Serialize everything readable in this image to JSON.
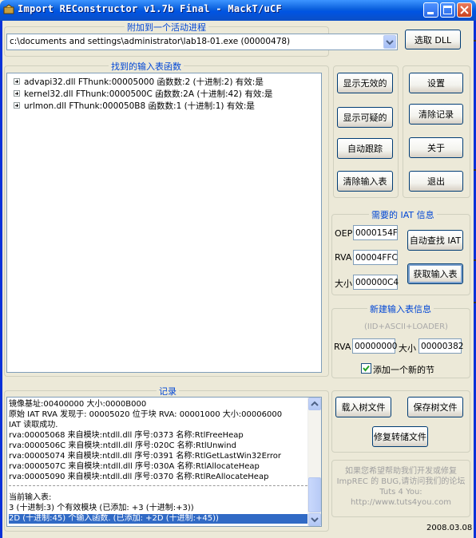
{
  "window": {
    "title": "Import REConstructor v1.7b Final - MackT/uCF"
  },
  "attach": {
    "group_title": "附加到一个活动进程",
    "process_value": "c:\\documents and settings\\administrator\\lab18-01.exe (00000478)",
    "pick_dll_label": "选取 DLL"
  },
  "imports": {
    "group_title": "找到的输入表函数",
    "items": [
      "advapi32.dll FThunk:00005000 函数数:2 (十进制:2) 有效:是",
      "kernel32.dll FThunk:0000500C 函数数:2A (十进制:42) 有效:是",
      "urlmon.dll FThunk:000050B8 函数数:1 (十进制:1) 有效:是"
    ]
  },
  "actions": {
    "show_invalid": "显示无效的",
    "show_suspect": "显示可疑的",
    "auto_trace": "自动跟踪",
    "clear_imports": "清除输入表",
    "settings": "设置",
    "clear_log": "清除记录",
    "about": "关于",
    "exit": "退出"
  },
  "iat": {
    "group_title": "需要的 IAT 信息",
    "oep_label": "OEP",
    "oep_value": "0000154F",
    "rva_label": "RVA",
    "rva_value": "00004FFC",
    "size_label": "大小",
    "size_value": "000000C4",
    "auto_search_label": "自动查找 IAT",
    "get_imports_label": "获取输入表"
  },
  "new_import": {
    "group_title": "新建输入表信息",
    "subtitle": "(IID+ASCII+LOADER)",
    "rva_label": "RVA",
    "rva_value": "00000000",
    "size_label": "大小",
    "size_value": "00000382",
    "add_section_label": "添加一个新的节",
    "add_section_checked": true
  },
  "log": {
    "group_title": "记录",
    "lines": [
      "镜像基址:00400000 大小:0000B000",
      "原始 IAT RVA 发现于: 00005020 位于块 RVA: 00001000 大小:00006000",
      "IAT 读取成功.",
      "rva:00005068 来自模块:ntdll.dll 序号:0373 名称:RtlFreeHeap",
      "rva:0000506C 来自模块:ntdll.dll 序号:020C 名称:RtlUnwind",
      "rva:00005074 来自模块:ntdll.dll 序号:0391 名称:RtlGetLastWin32Error",
      "rva:0000507C 来自模块:ntdll.dll 序号:030A 名称:RtlAllocateHeap",
      "rva:00005090 来自模块:ntdll.dll 序号:0370 名称:RtlReAllocateHeap",
      "当前输入表:",
      "3 (十进制:3) 个有效模块 (已添加: +3 (十进制:+3))",
      "2D (十进制:45) 个输入函数. (已添加: +2D (十进制:+45))"
    ]
  },
  "tree_file": {
    "load_label": "载入树文件",
    "save_label": "保存树文件",
    "fix_dump_label": "修复转储文件"
  },
  "footer": {
    "info_line1": "如果您希望帮助我们开发或修复",
    "info_line2": "ImpREC 的 BUG,请访问我们的论坛",
    "info_line3": "Tuts 4 You: http://www.tuts4you.com",
    "date": "2008.03.08"
  }
}
